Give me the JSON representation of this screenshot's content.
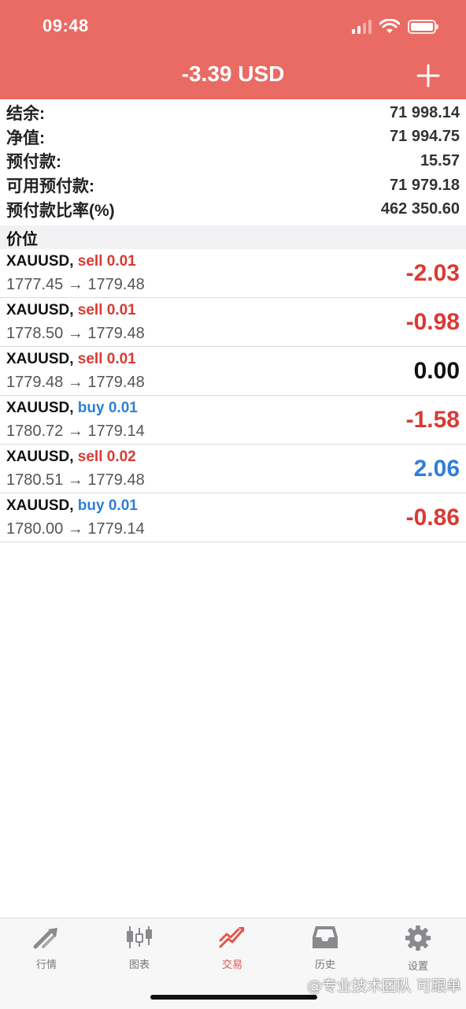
{
  "status_bar": {
    "time": "09:48"
  },
  "header": {
    "title": "-3.39 USD",
    "add_icon": "plus-icon"
  },
  "summary": [
    {
      "label": "结余:",
      "value": "71 998.14"
    },
    {
      "label": "净值:",
      "value": "71 994.75"
    },
    {
      "label": "预付款:",
      "value": "15.57"
    },
    {
      "label": "可用预付款:",
      "value": "71 979.18"
    },
    {
      "label": "预付款比率(%)",
      "value": "462 350.60"
    }
  ],
  "section_title": "价位",
  "positions": [
    {
      "symbol": "XAUUSD,",
      "side": "sell 0.01",
      "side_type": "sell",
      "prices": "1777.45 → 1779.48",
      "profit": "-2.03",
      "profit_color": "red"
    },
    {
      "symbol": "XAUUSD,",
      "side": "sell 0.01",
      "side_type": "sell",
      "prices": "1778.50 → 1779.48",
      "profit": "-0.98",
      "profit_color": "red"
    },
    {
      "symbol": "XAUUSD,",
      "side": "sell 0.01",
      "side_type": "sell",
      "prices": "1779.48 → 1779.48",
      "profit": "0.00",
      "profit_color": "black"
    },
    {
      "symbol": "XAUUSD,",
      "side": "buy 0.01",
      "side_type": "buy",
      "prices": "1780.72 → 1779.14",
      "profit": "-1.58",
      "profit_color": "red"
    },
    {
      "symbol": "XAUUSD,",
      "side": "sell 0.02",
      "side_type": "sell",
      "prices": "1780.51 → 1779.48",
      "profit": "2.06",
      "profit_color": "blue"
    },
    {
      "symbol": "XAUUSD,",
      "side": "buy 0.01",
      "side_type": "buy",
      "prices": "1780.00 → 1779.14",
      "profit": "-0.86",
      "profit_color": "red"
    }
  ],
  "tabbar": {
    "items": [
      {
        "label": "行情",
        "icon": "quotes-icon",
        "active": false
      },
      {
        "label": "图表",
        "icon": "chart-icon",
        "active": false
      },
      {
        "label": "交易",
        "icon": "trade-icon",
        "active": true
      },
      {
        "label": "历史",
        "icon": "history-icon",
        "active": false
      },
      {
        "label": "设置",
        "icon": "gear-icon",
        "active": false
      }
    ]
  },
  "watermark": "@专业技术团队 可跟单",
  "colors": {
    "header": "#E96B63",
    "sell": "#D93A33",
    "buy": "#2F7FD6",
    "active_tab": "#E2564E"
  }
}
